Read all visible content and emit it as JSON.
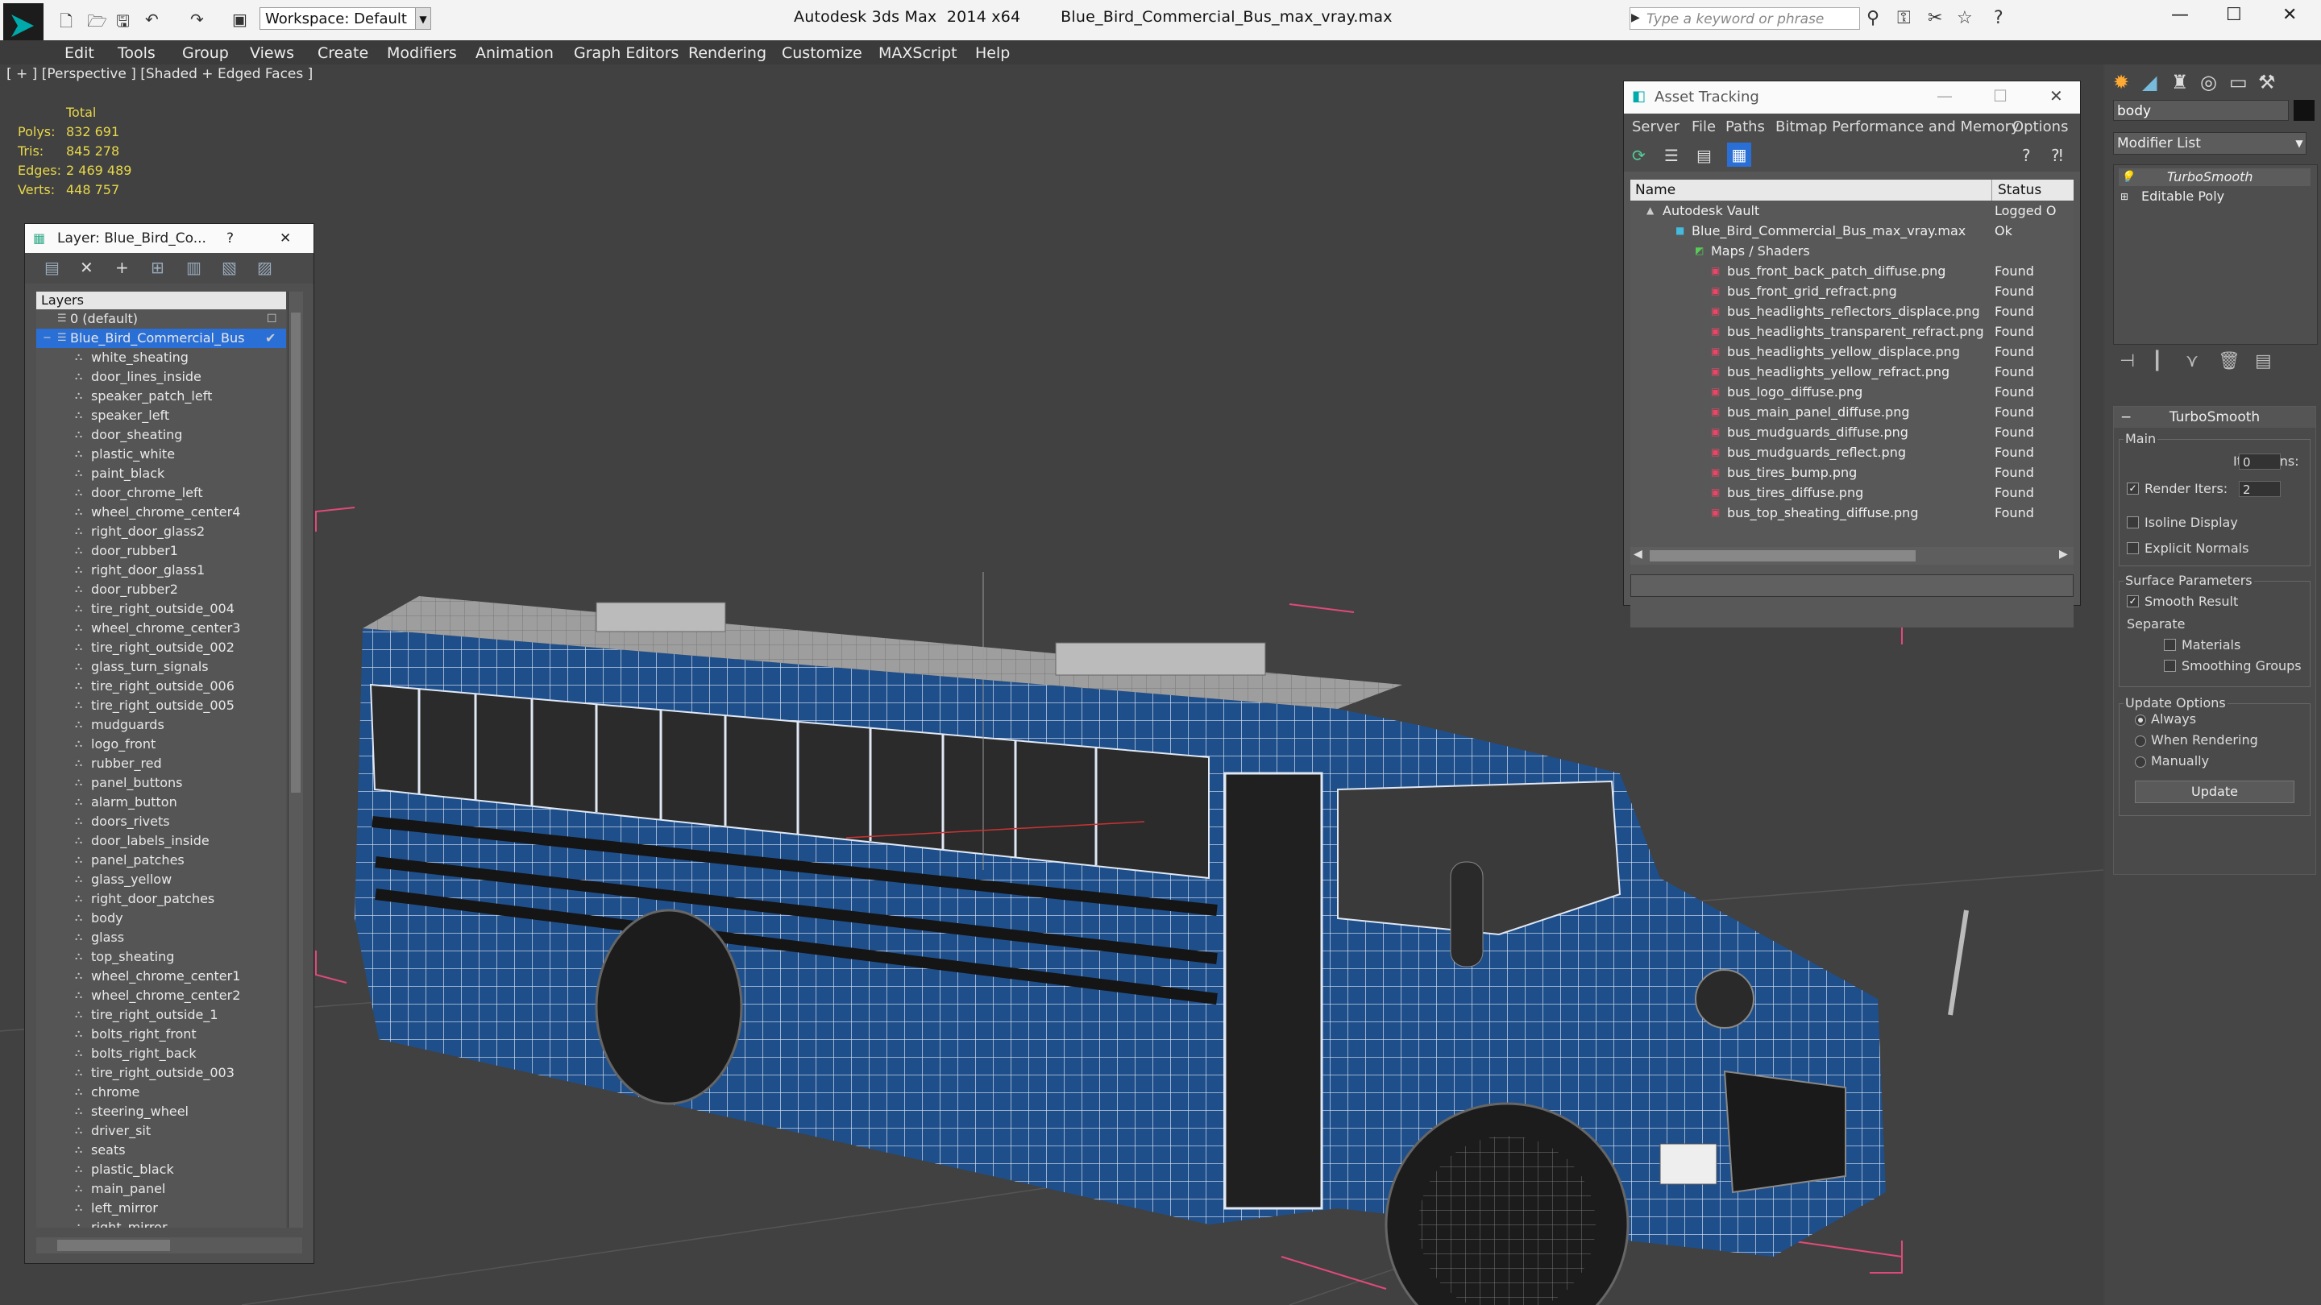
{
  "titlebar": {
    "title": "Autodesk 3ds Max  2014 x64        Blue_Bird_Commercial_Bus_max_vray.max",
    "workspace": "Workspace: Default",
    "search_placeholder": "Type a keyword or phrase",
    "minimize": "—",
    "maximize": "☐",
    "close": "✕"
  },
  "menu": [
    "Edit",
    "Tools",
    "Group",
    "Views",
    "Create",
    "Modifiers",
    "Animation",
    "Graph Editors",
    "Rendering",
    "Customize",
    "MAXScript",
    "Help"
  ],
  "viewport": {
    "label": "[ + ] [Perspective ] [Shaded + Edged Faces ]",
    "stats": {
      "header": "Total",
      "rows": [
        {
          "label": "Polys:",
          "value": "832 691"
        },
        {
          "label": "Tris:",
          "value": "845 278"
        },
        {
          "label": "Edges:",
          "value": "2 469 489"
        },
        {
          "label": "Verts:",
          "value": "448 757"
        }
      ]
    }
  },
  "layer_panel": {
    "title": "Layer: Blue_Bird_Co...",
    "help": "?",
    "close": "✕",
    "column": "Layers",
    "default_layer": "0 (default)",
    "selected_layer": "Blue_Bird_Commercial_Bus",
    "items": [
      "white_sheating",
      "door_lines_inside",
      "speaker_patch_left",
      "speaker_left",
      "door_sheating",
      "plastic_white",
      "paint_black",
      "door_chrome_left",
      "wheel_chrome_center4",
      "right_door_glass2",
      "door_rubber1",
      "right_door_glass1",
      "door_rubber2",
      "tire_right_outside_004",
      "wheel_chrome_center3",
      "tire_right_outside_002",
      "glass_turn_signals",
      "tire_right_outside_006",
      "tire_right_outside_005",
      "mudguards",
      "logo_front",
      "rubber_red",
      "panel_buttons",
      "alarm_button",
      "doors_rivets",
      "door_labels_inside",
      "panel_patches",
      "glass_yellow",
      "right_door_patches",
      "body",
      "glass",
      "top_sheating",
      "wheel_chrome_center1",
      "wheel_chrome_center2",
      "tire_right_outside_1",
      "bolts_right_front",
      "bolts_right_back",
      "tire_right_outside_003",
      "chrome",
      "steering_wheel",
      "driver_sit",
      "seats",
      "plastic_black",
      "main_panel",
      "left_mirror",
      "right_mirror"
    ]
  },
  "asset_tracking": {
    "title": "Asset Tracking",
    "menu": [
      "Server",
      "File",
      "Paths",
      "Bitmap Performance and Memory",
      "Options"
    ],
    "col_name": "Name",
    "col_status": "Status",
    "vault": {
      "name": "Autodesk Vault",
      "status": "Logged O"
    },
    "file": {
      "name": "Blue_Bird_Commercial_Bus_max_vray.max",
      "status": "Ok"
    },
    "folder": "Maps / Shaders",
    "maps": [
      {
        "name": "bus_front_back_patch_diffuse.png",
        "status": "Found"
      },
      {
        "name": "bus_front_grid_refract.png",
        "status": "Found"
      },
      {
        "name": "bus_headlights_reflectors_displace.png",
        "status": "Found"
      },
      {
        "name": "bus_headlights_transparent_refract.png",
        "status": "Found"
      },
      {
        "name": "bus_headlights_yellow_displace.png",
        "status": "Found"
      },
      {
        "name": "bus_headlights_yellow_refract.png",
        "status": "Found"
      },
      {
        "name": "bus_logo_diffuse.png",
        "status": "Found"
      },
      {
        "name": "bus_main_panel_diffuse.png",
        "status": "Found"
      },
      {
        "name": "bus_mudguards_diffuse.png",
        "status": "Found"
      },
      {
        "name": "bus_mudguards_reflect.png",
        "status": "Found"
      },
      {
        "name": "bus_tires_bump.png",
        "status": "Found"
      },
      {
        "name": "bus_tires_diffuse.png",
        "status": "Found"
      },
      {
        "name": "bus_top_sheating_diffuse.png",
        "status": "Found"
      }
    ]
  },
  "command_panel": {
    "object_name": "body",
    "modifier_list": "Modifier List",
    "stack": [
      "TurboSmooth",
      "Editable Poly"
    ],
    "turbosmooth": {
      "title": "TurboSmooth",
      "main": "Main",
      "iterations_label": "Iterations:",
      "iterations": "0",
      "render_iters_label": "Render Iters:",
      "render_iters": "2",
      "isoline": "Isoline Display",
      "explicit": "Explicit Normals",
      "surface": "Surface Parameters",
      "smooth_result": "Smooth Result",
      "separate": "Separate",
      "materials": "Materials",
      "smoothing_groups": "Smoothing Groups",
      "update_options": "Update Options",
      "always": "Always",
      "when_rendering": "When Rendering",
      "manually": "Manually",
      "update": "Update"
    }
  },
  "colors": {
    "bus_blue": "#1f4f8a",
    "wire": "#e8eef8",
    "stats_yellow": "#e8d84a",
    "selection": "#2a6fd6"
  }
}
